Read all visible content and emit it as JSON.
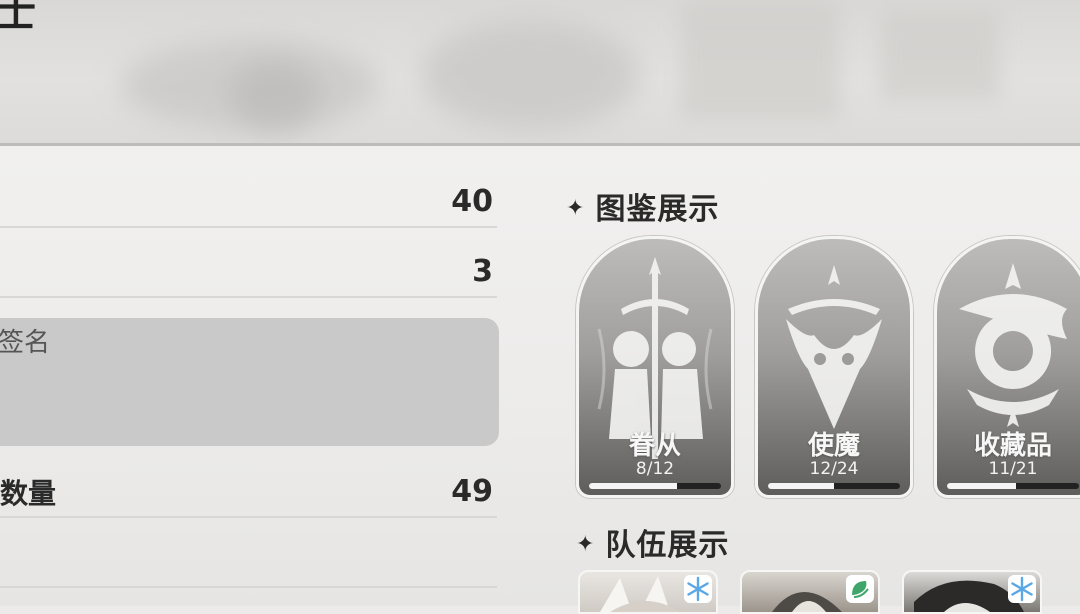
{
  "header": {
    "title": "士"
  },
  "stats": [
    {
      "label": "",
      "value": "40"
    },
    {
      "label": "",
      "value": "3"
    }
  ],
  "signature": {
    "label": "签名"
  },
  "count_row": {
    "label": "数量",
    "value": "49"
  },
  "gallery": {
    "title": "图鉴展示",
    "cards": [
      {
        "name": "眷从",
        "count": "8/12",
        "progress": 0.667
      },
      {
        "name": "使魔",
        "count": "12/24",
        "progress": 0.5
      },
      {
        "name": "收藏品",
        "count": "11/21",
        "progress": 0.524
      }
    ]
  },
  "team": {
    "title": "队伍展示",
    "members": [
      {
        "element_icon": "snowflake-icon",
        "element_color": "#5aa7e6"
      },
      {
        "element_icon": "leaf-swirl-icon",
        "element_color": "#3fa56a"
      },
      {
        "element_icon": "snowflake-icon",
        "element_color": "#5aa7e6"
      }
    ]
  }
}
